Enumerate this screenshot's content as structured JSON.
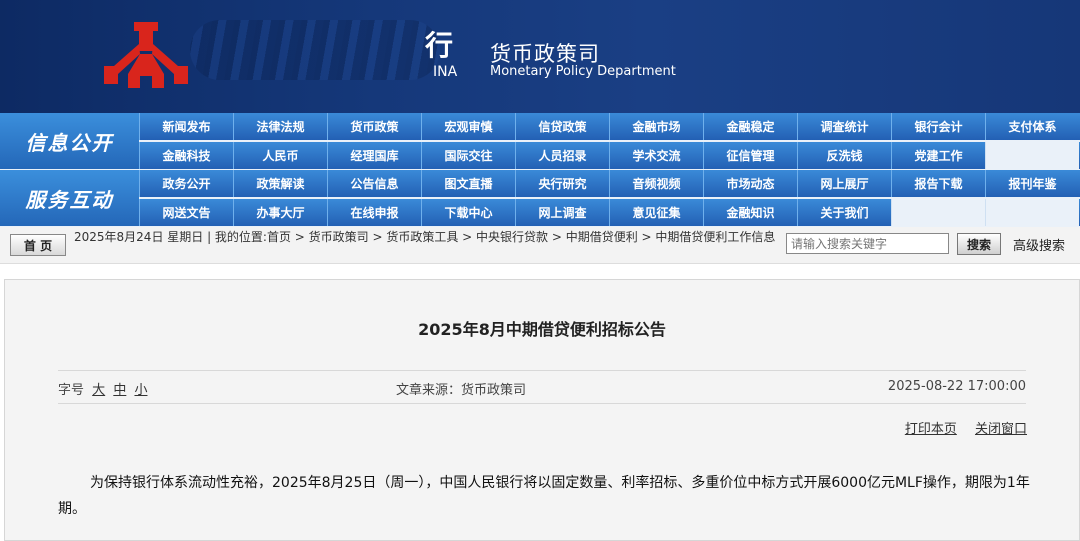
{
  "header": {
    "bank_name_fragment": "行",
    "ina": "INA",
    "dept_title": "货币政策司",
    "dept_subtitle": "Monetary Policy Department"
  },
  "nav": {
    "sections": [
      {
        "label": "信息公开",
        "rows": [
          [
            "新闻发布",
            "法律法规",
            "货币政策",
            "宏观审慎",
            "信贷政策",
            "金融市场",
            "金融稳定",
            "调查统计",
            "银行会计",
            "支付体系"
          ],
          [
            "金融科技",
            "人民币",
            "经理国库",
            "国际交往",
            "人员招录",
            "学术交流",
            "征信管理",
            "反洗钱",
            "党建工作",
            ""
          ]
        ]
      },
      {
        "label": "服务互动",
        "rows": [
          [
            "政务公开",
            "政策解读",
            "公告信息",
            "图文直播",
            "央行研究",
            "音频视频",
            "市场动态",
            "网上展厅",
            "报告下载",
            "报刊年鉴"
          ],
          [
            "网送文告",
            "办事大厅",
            "在线申报",
            "下载中心",
            "网上调查",
            "意见征集",
            "金融知识",
            "关于我们",
            "",
            ""
          ]
        ]
      }
    ]
  },
  "location": {
    "home_label": "首 页",
    "text": "2025年8月24日 星期日 | 我的位置:首页 > 货币政策司 > 货币政策工具 > 中央银行贷款 > 中期借贷便利 > 中期借贷便利工作信息",
    "search_placeholder": "请输入搜索关键字",
    "search_label": "搜索",
    "advanced_search": "高级搜索"
  },
  "article": {
    "title": "2025年8月中期借贷便利招标公告",
    "font_size_label": "字号",
    "font_sizes": [
      "大",
      "中",
      "小"
    ],
    "source": "文章来源：货币政策司",
    "date": "2025-08-22 17:00:00",
    "print_label": "打印本页",
    "close_label": "关闭窗口",
    "body": "为保持银行体系流动性充裕，2025年8月25日（周一），中国人民银行将以固定数量、利率招标、多重价位中标方式开展6000亿元MLF操作，期限为1年期。"
  },
  "colors": {
    "banner": "#163778",
    "nav_blue": "#2d74c6",
    "logo_red": "#d9251c"
  }
}
